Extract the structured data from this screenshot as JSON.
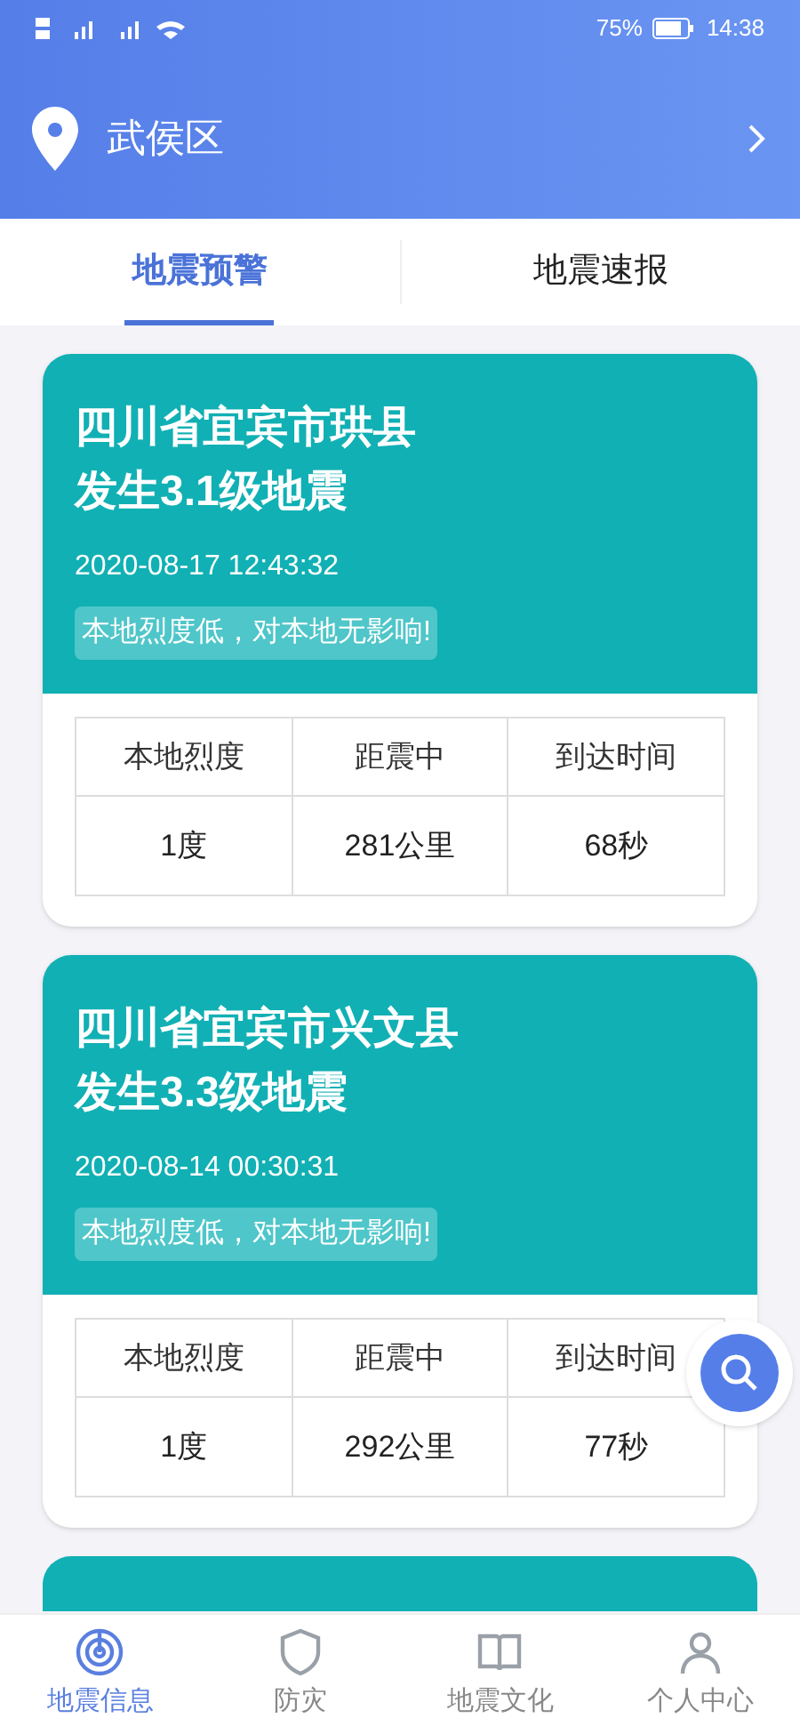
{
  "status_bar": {
    "battery": "75%",
    "time": "14:38"
  },
  "header": {
    "location": "武侯区"
  },
  "tabs": [
    {
      "label": "地震预警",
      "selected": true
    },
    {
      "label": "地震速报",
      "selected": false
    }
  ],
  "quakes": [
    {
      "place": "四川省宜宾市珙县",
      "title": "发生3.1级地震",
      "time": "2020-08-17 12:43:32",
      "notice": "本地烈度低，对本地无影响!",
      "columns": [
        "本地烈度",
        "距震中",
        "到达时间"
      ],
      "values": [
        "1度",
        "281公里",
        "68秒"
      ]
    },
    {
      "place": "四川省宜宾市兴文县",
      "title": "发生3.3级地震",
      "time": "2020-08-14 00:30:31",
      "notice": "本地烈度低，对本地无影响!",
      "columns": [
        "本地烈度",
        "距震中",
        "到达时间"
      ],
      "values": [
        "1度",
        "292公里",
        "77秒"
      ]
    }
  ],
  "bottom_nav": [
    {
      "label": "地震信息",
      "selected": true
    },
    {
      "label": "防灾",
      "selected": false
    },
    {
      "label": "地震文化",
      "selected": false
    },
    {
      "label": "个人中心",
      "selected": false
    }
  ]
}
